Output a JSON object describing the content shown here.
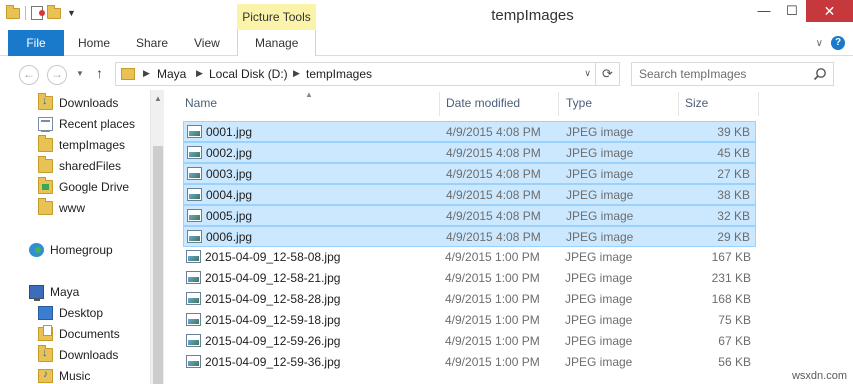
{
  "window": {
    "title": "tempImages",
    "contextual_tab_group": "Picture Tools",
    "min_symbol": "—",
    "max_symbol": "☐",
    "close_symbol": "✕"
  },
  "ribbon": {
    "file_tab": "File",
    "tabs": [
      "Home",
      "Share",
      "View",
      "Manage"
    ],
    "file_color": "#1979ca",
    "contextual_color": "#fbf3a9"
  },
  "address": {
    "crumbs": [
      "Maya",
      "Local Disk (D:)",
      "tempImages"
    ],
    "search_placeholder": "Search tempImages"
  },
  "navpane": {
    "favorites": [
      {
        "label": "Downloads",
        "icon": "downloads-folder-icon"
      },
      {
        "label": "Recent places",
        "icon": "recent-places-icon"
      },
      {
        "label": "tempImages",
        "icon": "folder-icon"
      },
      {
        "label": "sharedFiles",
        "icon": "folder-icon"
      },
      {
        "label": "Google Drive",
        "icon": "google-drive-icon"
      },
      {
        "label": "www",
        "icon": "folder-icon"
      }
    ],
    "homegroup": "Homegroup",
    "computer": "Maya",
    "computer_items": [
      {
        "label": "Desktop",
        "icon": "desktop-icon"
      },
      {
        "label": "Documents",
        "icon": "documents-icon"
      },
      {
        "label": "Downloads",
        "icon": "downloads-folder-icon"
      },
      {
        "label": "Music",
        "icon": "music-icon"
      }
    ]
  },
  "columns": {
    "name": "Name",
    "date": "Date modified",
    "type": "Type",
    "size": "Size"
  },
  "files": [
    {
      "name": "0001.jpg",
      "date": "4/9/2015 4:08 PM",
      "type": "JPEG image",
      "size": "39 KB",
      "selected": true
    },
    {
      "name": "0002.jpg",
      "date": "4/9/2015 4:08 PM",
      "type": "JPEG image",
      "size": "45 KB",
      "selected": true
    },
    {
      "name": "0003.jpg",
      "date": "4/9/2015 4:08 PM",
      "type": "JPEG image",
      "size": "27 KB",
      "selected": true
    },
    {
      "name": "0004.jpg",
      "date": "4/9/2015 4:08 PM",
      "type": "JPEG image",
      "size": "38 KB",
      "selected": true
    },
    {
      "name": "0005.jpg",
      "date": "4/9/2015 4:08 PM",
      "type": "JPEG image",
      "size": "32 KB",
      "selected": true
    },
    {
      "name": "0006.jpg",
      "date": "4/9/2015 4:08 PM",
      "type": "JPEG image",
      "size": "29 KB",
      "selected": true
    },
    {
      "name": "2015-04-09_12-58-08.jpg",
      "date": "4/9/2015 1:00 PM",
      "type": "JPEG image",
      "size": "167 KB",
      "selected": false
    },
    {
      "name": "2015-04-09_12-58-21.jpg",
      "date": "4/9/2015 1:00 PM",
      "type": "JPEG image",
      "size": "231 KB",
      "selected": false
    },
    {
      "name": "2015-04-09_12-58-28.jpg",
      "date": "4/9/2015 1:00 PM",
      "type": "JPEG image",
      "size": "168 KB",
      "selected": false
    },
    {
      "name": "2015-04-09_12-59-18.jpg",
      "date": "4/9/2015 1:00 PM",
      "type": "JPEG image",
      "size": "75 KB",
      "selected": false
    },
    {
      "name": "2015-04-09_12-59-26.jpg",
      "date": "4/9/2015 1:00 PM",
      "type": "JPEG image",
      "size": "67 KB",
      "selected": false
    },
    {
      "name": "2015-04-09_12-59-36.jpg",
      "date": "4/9/2015 1:00 PM",
      "type": "JPEG image",
      "size": "56 KB",
      "selected": false
    }
  ],
  "watermark": "wsxdn.com"
}
